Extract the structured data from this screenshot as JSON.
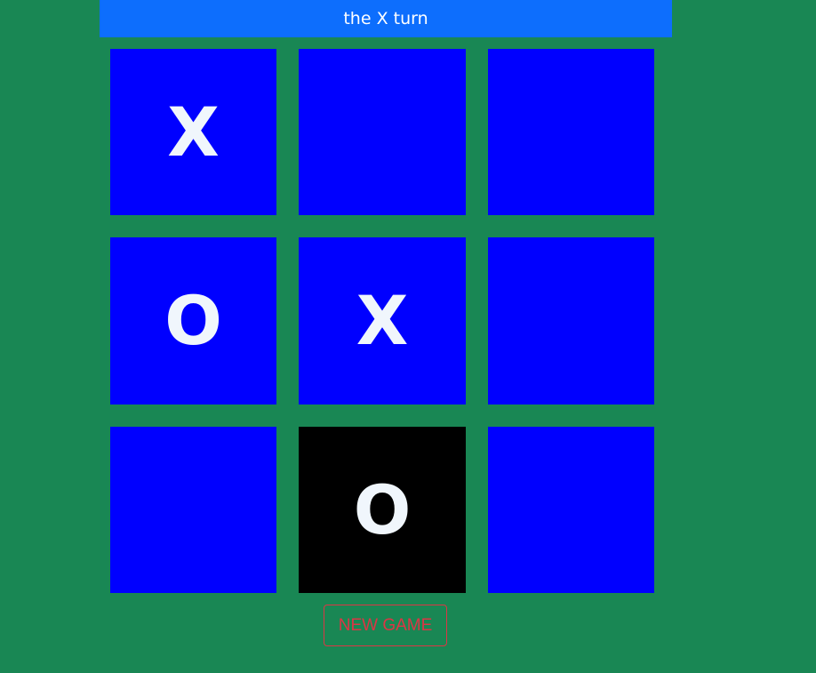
{
  "status": {
    "text": "the X turn"
  },
  "board": {
    "cells": [
      {
        "value": "X",
        "highlight": false
      },
      {
        "value": "",
        "highlight": false
      },
      {
        "value": "",
        "highlight": false
      },
      {
        "value": "O",
        "highlight": false
      },
      {
        "value": "X",
        "highlight": false
      },
      {
        "value": "",
        "highlight": false
      },
      {
        "value": "",
        "highlight": false
      },
      {
        "value": "O",
        "highlight": true
      },
      {
        "value": "",
        "highlight": false
      }
    ]
  },
  "controls": {
    "new_game_label": "NEW GAME"
  },
  "colors": {
    "background": "#198754",
    "status_bar": "#0d6efd",
    "cell": "#0000ff",
    "cell_highlight": "#000000",
    "mark": "#f0f6fc",
    "new_game": "#dc3545"
  }
}
